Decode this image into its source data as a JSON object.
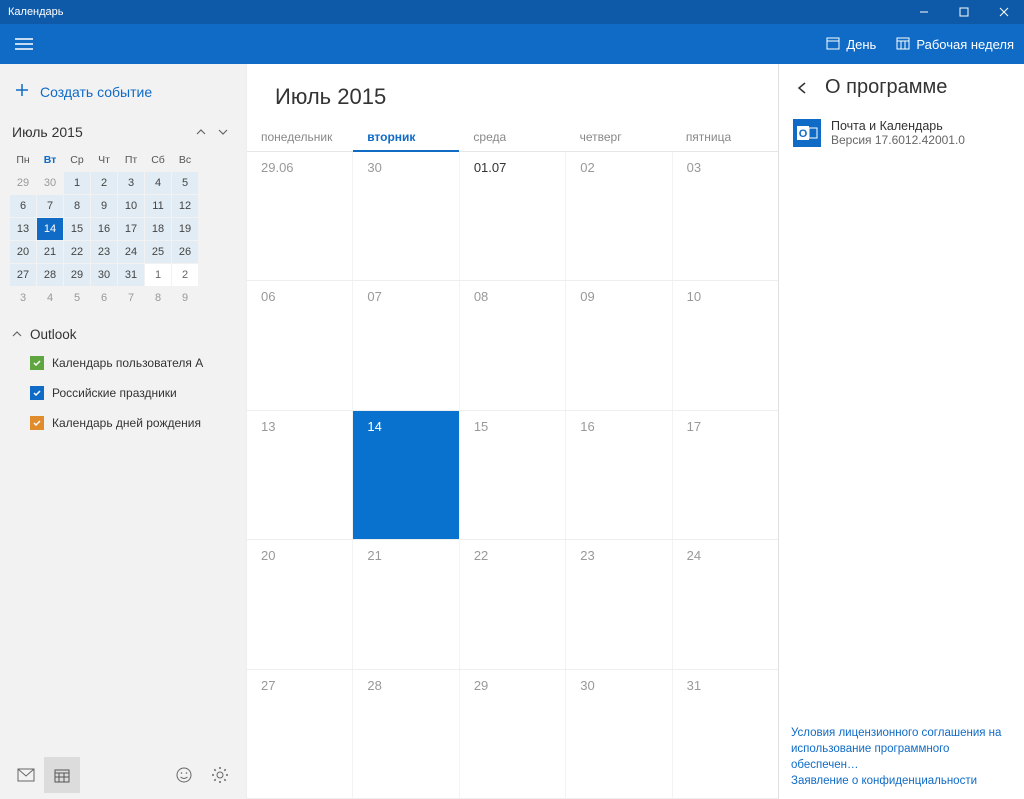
{
  "window": {
    "title": "Календарь"
  },
  "toolbar": {
    "day_label": "День",
    "work_week_label": "Рабочая неделя"
  },
  "sidebar": {
    "create_event_label": "Создать событие",
    "mini_calendar": {
      "title": "Июль 2015",
      "weekdays": [
        "Пн",
        "Вт",
        "Ср",
        "Чт",
        "Пт",
        "Сб",
        "Вс"
      ],
      "active_weekday_index": 1,
      "days": [
        {
          "n": "29",
          "out": true
        },
        {
          "n": "30",
          "out": true
        },
        {
          "n": "1"
        },
        {
          "n": "2"
        },
        {
          "n": "3"
        },
        {
          "n": "4"
        },
        {
          "n": "5"
        },
        {
          "n": "6"
        },
        {
          "n": "7"
        },
        {
          "n": "8"
        },
        {
          "n": "9"
        },
        {
          "n": "10"
        },
        {
          "n": "11"
        },
        {
          "n": "12"
        },
        {
          "n": "13"
        },
        {
          "n": "14",
          "today": true
        },
        {
          "n": "15"
        },
        {
          "n": "16"
        },
        {
          "n": "17"
        },
        {
          "n": "18"
        },
        {
          "n": "19"
        },
        {
          "n": "20"
        },
        {
          "n": "21"
        },
        {
          "n": "22"
        },
        {
          "n": "23"
        },
        {
          "n": "24"
        },
        {
          "n": "25"
        },
        {
          "n": "26"
        },
        {
          "n": "27"
        },
        {
          "n": "28"
        },
        {
          "n": "29"
        },
        {
          "n": "30"
        },
        {
          "n": "31"
        },
        {
          "n": "1",
          "aug": true
        },
        {
          "n": "2",
          "aug": true
        },
        {
          "n": "3",
          "out": true
        },
        {
          "n": "4",
          "out": true
        },
        {
          "n": "5",
          "out": true
        },
        {
          "n": "6",
          "out": true
        },
        {
          "n": "7",
          "out": true
        },
        {
          "n": "8",
          "out": true
        },
        {
          "n": "9",
          "out": true
        }
      ]
    },
    "account_header": "Outlook",
    "calendars": [
      {
        "label": "Календарь пользователя А",
        "color": "#5fa641",
        "checked": true
      },
      {
        "label": "Российские праздники",
        "color": "#0f6bc6",
        "checked": true
      },
      {
        "label": "Календарь дней рождения",
        "color": "#e08b2c",
        "checked": true
      }
    ]
  },
  "calendar": {
    "title": "Июль 2015",
    "weekdays": [
      "понедельник",
      "вторник",
      "среда",
      "четверг",
      "пятница"
    ],
    "active_col": 1,
    "weeks": [
      [
        {
          "n": "29.06"
        },
        {
          "n": "30"
        },
        {
          "n": "01.07",
          "first": true
        },
        {
          "n": "02"
        },
        {
          "n": "03"
        }
      ],
      [
        {
          "n": "06"
        },
        {
          "n": "07"
        },
        {
          "n": "08"
        },
        {
          "n": "09"
        },
        {
          "n": "10"
        }
      ],
      [
        {
          "n": "13"
        },
        {
          "n": "14",
          "today": true
        },
        {
          "n": "15"
        },
        {
          "n": "16"
        },
        {
          "n": "17"
        }
      ],
      [
        {
          "n": "20"
        },
        {
          "n": "21"
        },
        {
          "n": "22"
        },
        {
          "n": "23"
        },
        {
          "n": "24"
        }
      ],
      [
        {
          "n": "27"
        },
        {
          "n": "28"
        },
        {
          "n": "29"
        },
        {
          "n": "30"
        },
        {
          "n": "31"
        }
      ]
    ]
  },
  "about": {
    "title": "О программе",
    "app_name": "Почта и Календарь",
    "version": "Версия 17.6012.42001.0",
    "link_license": "Условия лицензионного соглашения на использование программного обеспечен…",
    "link_privacy": "Заявление о конфиденциальности"
  }
}
